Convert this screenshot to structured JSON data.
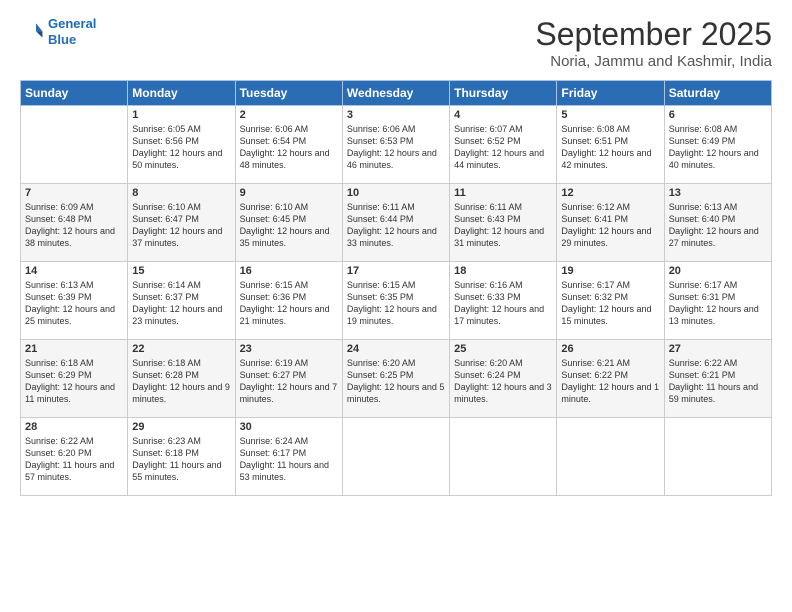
{
  "logo": {
    "line1": "General",
    "line2": "Blue"
  },
  "title": "September 2025",
  "subtitle": "Noria, Jammu and Kashmir, India",
  "days_of_week": [
    "Sunday",
    "Monday",
    "Tuesday",
    "Wednesday",
    "Thursday",
    "Friday",
    "Saturday"
  ],
  "weeks": [
    [
      {
        "day": "",
        "sunrise": "",
        "sunset": "",
        "daylight": ""
      },
      {
        "day": "1",
        "sunrise": "Sunrise: 6:05 AM",
        "sunset": "Sunset: 6:56 PM",
        "daylight": "Daylight: 12 hours and 50 minutes."
      },
      {
        "day": "2",
        "sunrise": "Sunrise: 6:06 AM",
        "sunset": "Sunset: 6:54 PM",
        "daylight": "Daylight: 12 hours and 48 minutes."
      },
      {
        "day": "3",
        "sunrise": "Sunrise: 6:06 AM",
        "sunset": "Sunset: 6:53 PM",
        "daylight": "Daylight: 12 hours and 46 minutes."
      },
      {
        "day": "4",
        "sunrise": "Sunrise: 6:07 AM",
        "sunset": "Sunset: 6:52 PM",
        "daylight": "Daylight: 12 hours and 44 minutes."
      },
      {
        "day": "5",
        "sunrise": "Sunrise: 6:08 AM",
        "sunset": "Sunset: 6:51 PM",
        "daylight": "Daylight: 12 hours and 42 minutes."
      },
      {
        "day": "6",
        "sunrise": "Sunrise: 6:08 AM",
        "sunset": "Sunset: 6:49 PM",
        "daylight": "Daylight: 12 hours and 40 minutes."
      }
    ],
    [
      {
        "day": "7",
        "sunrise": "Sunrise: 6:09 AM",
        "sunset": "Sunset: 6:48 PM",
        "daylight": "Daylight: 12 hours and 38 minutes."
      },
      {
        "day": "8",
        "sunrise": "Sunrise: 6:10 AM",
        "sunset": "Sunset: 6:47 PM",
        "daylight": "Daylight: 12 hours and 37 minutes."
      },
      {
        "day": "9",
        "sunrise": "Sunrise: 6:10 AM",
        "sunset": "Sunset: 6:45 PM",
        "daylight": "Daylight: 12 hours and 35 minutes."
      },
      {
        "day": "10",
        "sunrise": "Sunrise: 6:11 AM",
        "sunset": "Sunset: 6:44 PM",
        "daylight": "Daylight: 12 hours and 33 minutes."
      },
      {
        "day": "11",
        "sunrise": "Sunrise: 6:11 AM",
        "sunset": "Sunset: 6:43 PM",
        "daylight": "Daylight: 12 hours and 31 minutes."
      },
      {
        "day": "12",
        "sunrise": "Sunrise: 6:12 AM",
        "sunset": "Sunset: 6:41 PM",
        "daylight": "Daylight: 12 hours and 29 minutes."
      },
      {
        "day": "13",
        "sunrise": "Sunrise: 6:13 AM",
        "sunset": "Sunset: 6:40 PM",
        "daylight": "Daylight: 12 hours and 27 minutes."
      }
    ],
    [
      {
        "day": "14",
        "sunrise": "Sunrise: 6:13 AM",
        "sunset": "Sunset: 6:39 PM",
        "daylight": "Daylight: 12 hours and 25 minutes."
      },
      {
        "day": "15",
        "sunrise": "Sunrise: 6:14 AM",
        "sunset": "Sunset: 6:37 PM",
        "daylight": "Daylight: 12 hours and 23 minutes."
      },
      {
        "day": "16",
        "sunrise": "Sunrise: 6:15 AM",
        "sunset": "Sunset: 6:36 PM",
        "daylight": "Daylight: 12 hours and 21 minutes."
      },
      {
        "day": "17",
        "sunrise": "Sunrise: 6:15 AM",
        "sunset": "Sunset: 6:35 PM",
        "daylight": "Daylight: 12 hours and 19 minutes."
      },
      {
        "day": "18",
        "sunrise": "Sunrise: 6:16 AM",
        "sunset": "Sunset: 6:33 PM",
        "daylight": "Daylight: 12 hours and 17 minutes."
      },
      {
        "day": "19",
        "sunrise": "Sunrise: 6:17 AM",
        "sunset": "Sunset: 6:32 PM",
        "daylight": "Daylight: 12 hours and 15 minutes."
      },
      {
        "day": "20",
        "sunrise": "Sunrise: 6:17 AM",
        "sunset": "Sunset: 6:31 PM",
        "daylight": "Daylight: 12 hours and 13 minutes."
      }
    ],
    [
      {
        "day": "21",
        "sunrise": "Sunrise: 6:18 AM",
        "sunset": "Sunset: 6:29 PM",
        "daylight": "Daylight: 12 hours and 11 minutes."
      },
      {
        "day": "22",
        "sunrise": "Sunrise: 6:18 AM",
        "sunset": "Sunset: 6:28 PM",
        "daylight": "Daylight: 12 hours and 9 minutes."
      },
      {
        "day": "23",
        "sunrise": "Sunrise: 6:19 AM",
        "sunset": "Sunset: 6:27 PM",
        "daylight": "Daylight: 12 hours and 7 minutes."
      },
      {
        "day": "24",
        "sunrise": "Sunrise: 6:20 AM",
        "sunset": "Sunset: 6:25 PM",
        "daylight": "Daylight: 12 hours and 5 minutes."
      },
      {
        "day": "25",
        "sunrise": "Sunrise: 6:20 AM",
        "sunset": "Sunset: 6:24 PM",
        "daylight": "Daylight: 12 hours and 3 minutes."
      },
      {
        "day": "26",
        "sunrise": "Sunrise: 6:21 AM",
        "sunset": "Sunset: 6:22 PM",
        "daylight": "Daylight: 12 hours and 1 minute."
      },
      {
        "day": "27",
        "sunrise": "Sunrise: 6:22 AM",
        "sunset": "Sunset: 6:21 PM",
        "daylight": "Daylight: 11 hours and 59 minutes."
      }
    ],
    [
      {
        "day": "28",
        "sunrise": "Sunrise: 6:22 AM",
        "sunset": "Sunset: 6:20 PM",
        "daylight": "Daylight: 11 hours and 57 minutes."
      },
      {
        "day": "29",
        "sunrise": "Sunrise: 6:23 AM",
        "sunset": "Sunset: 6:18 PM",
        "daylight": "Daylight: 11 hours and 55 minutes."
      },
      {
        "day": "30",
        "sunrise": "Sunrise: 6:24 AM",
        "sunset": "Sunset: 6:17 PM",
        "daylight": "Daylight: 11 hours and 53 minutes."
      },
      {
        "day": "",
        "sunrise": "",
        "sunset": "",
        "daylight": ""
      },
      {
        "day": "",
        "sunrise": "",
        "sunset": "",
        "daylight": ""
      },
      {
        "day": "",
        "sunrise": "",
        "sunset": "",
        "daylight": ""
      },
      {
        "day": "",
        "sunrise": "",
        "sunset": "",
        "daylight": ""
      }
    ]
  ]
}
